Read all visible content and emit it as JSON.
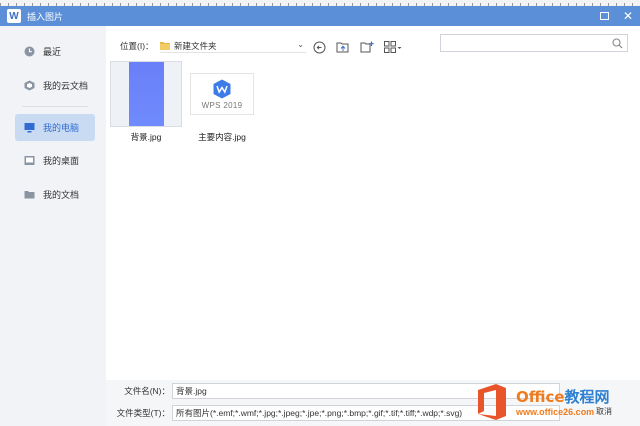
{
  "window": {
    "title": "插入图片"
  },
  "sidebar": {
    "items": [
      {
        "label": "最近",
        "icon": "clock-icon"
      },
      {
        "label": "我的云文档",
        "icon": "cloud-doc-icon"
      },
      {
        "label": "我的电脑",
        "icon": "computer-icon",
        "active": true
      },
      {
        "label": "我的桌面",
        "icon": "desktop-icon"
      },
      {
        "label": "我的文档",
        "icon": "folder-icon"
      }
    ]
  },
  "location": {
    "label": "位置(I)：",
    "value": "新建文件夹"
  },
  "search": {
    "placeholder": ""
  },
  "files": [
    {
      "name": "背景.jpg"
    },
    {
      "name": "主要内容.jpg",
      "thumb_text": "WPS 2019"
    }
  ],
  "footer": {
    "filename_label": "文件名(N)：",
    "filename_value": "背景.jpg",
    "filetype_label": "文件类型(T)：",
    "filetype_value": "所有图片(*.emf;*.wmf;*.jpg;*.jpeg;*.jpe;*.png;*.bmp;*.gif;*.tif;*.tiff;*.wdp;*.svg)",
    "cancel_label": "取消"
  },
  "watermark": {
    "brand_a": "Office",
    "brand_b": "教程网",
    "url": "www.office26.com"
  },
  "colors": {
    "titlebar": "#5b8fd8",
    "accent": "#2f6bd0",
    "active_bg": "#c9dbf3"
  }
}
